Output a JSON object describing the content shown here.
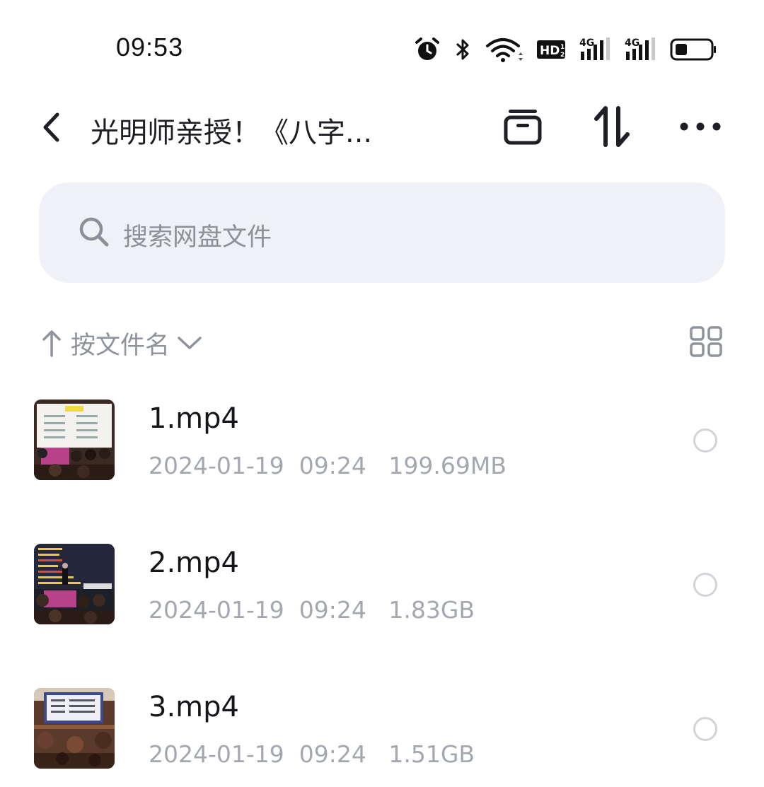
{
  "status_bar": {
    "time": "09:53",
    "icons": [
      "alarm-icon",
      "bluetooth-icon",
      "wifi-icon",
      "hd-icon",
      "signal-4g-icon",
      "signal-4g-icon",
      "battery-icon"
    ],
    "hd_label": "HD",
    "network_label": "4G"
  },
  "header": {
    "title": "光明师亲授！《八字...",
    "actions": [
      "archive-icon",
      "transfer-icon",
      "more-icon"
    ]
  },
  "search": {
    "placeholder": "搜索网盘文件"
  },
  "sort": {
    "label": "按文件名"
  },
  "files": [
    {
      "name": "1.mp4",
      "date": "2024-01-19",
      "time": "09:24",
      "size": "199.69MB"
    },
    {
      "name": "2.mp4",
      "date": "2024-01-19",
      "time": "09:24",
      "size": "1.83GB"
    },
    {
      "name": "3.mp4",
      "date": "2024-01-19",
      "time": "09:24",
      "size": "1.51GB"
    }
  ],
  "colors": {
    "search_bg": "#eff1f6",
    "muted_text": "#a3a7b0",
    "primary_text": "#15151a"
  }
}
